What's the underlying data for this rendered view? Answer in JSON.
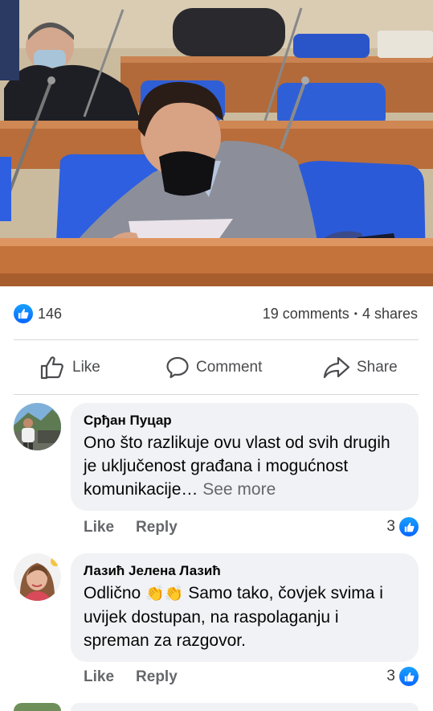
{
  "post": {
    "reactions": {
      "like_count": "146",
      "comments": "19 comments",
      "separator": "•",
      "shares": "4 shares"
    },
    "actions": {
      "like": "Like",
      "comment": "Comment",
      "share": "Share"
    }
  },
  "comments": [
    {
      "author": "Срђан Пуцар",
      "text": "Ono što razlikuje ovu vlast od svih drugih je uključenost građana i mogućnost komunikacije…",
      "see_more": "See more",
      "like_label": "Like",
      "reply_label": "Reply",
      "reaction_count": "3"
    },
    {
      "author": "Лазић Јелена Лазић",
      "text_before": "Odlično",
      "emoji": "👏👏",
      "text_after": "Samo tako, čovjek svima i uvijek dostupan, na raspolaganju i spreman za razgovor.",
      "like_label": "Like",
      "reply_label": "Reply",
      "reaction_count": "3"
    }
  ],
  "colors": {
    "accent": "#0866ff",
    "bubble": "#f0f2f5",
    "muted": "#65676b"
  }
}
